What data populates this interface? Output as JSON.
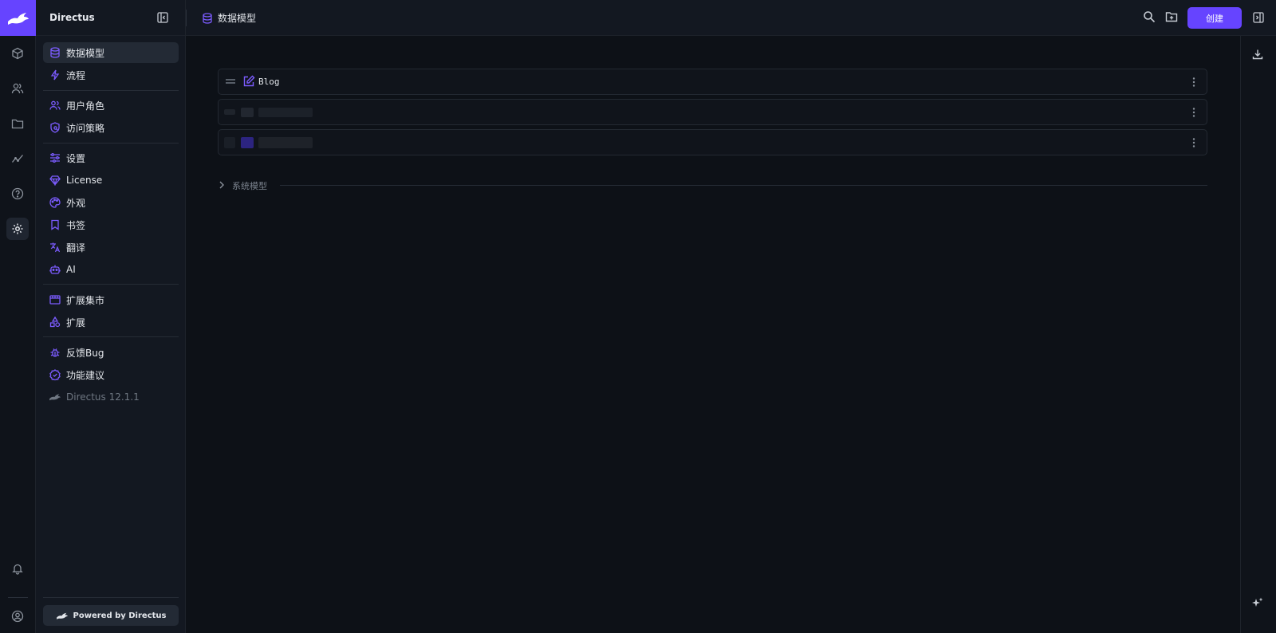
{
  "app": {
    "name": "Directus",
    "accent": "#6644ff"
  },
  "modules": [
    "content-module-icon",
    "users-module-icon",
    "files-module-icon",
    "insights-module-icon",
    "help-module-icon",
    "settings-module-icon"
  ],
  "nav": {
    "items": [
      {
        "label": "数据模型",
        "icon": "database-icon"
      },
      {
        "label": "流程",
        "icon": "bolt-icon"
      },
      {
        "label": "用户角色",
        "icon": "group-icon"
      },
      {
        "label": "访问策略",
        "icon": "policy-icon"
      },
      {
        "label": "设置",
        "icon": "sliders-icon"
      },
      {
        "label": "License",
        "icon": "diamond-icon"
      },
      {
        "label": "外观",
        "icon": "palette-icon"
      },
      {
        "label": "书签",
        "icon": "bookmark-icon"
      },
      {
        "label": "翻译",
        "icon": "translate-icon"
      },
      {
        "label": "AI",
        "icon": "robot-icon"
      },
      {
        "label": "扩展集市",
        "icon": "storefront-icon"
      },
      {
        "label": "扩展",
        "icon": "shapes-icon"
      },
      {
        "label": "反馈Bug",
        "icon": "bug-icon"
      },
      {
        "label": "功能建议",
        "icon": "verified-icon"
      },
      {
        "label": "Directus 12.1.1",
        "icon": "directus-logo-icon"
      }
    ],
    "powered_by": "Powered by Directus"
  },
  "header": {
    "breadcrumb": "数据模型",
    "create_label": "创建"
  },
  "collections": [
    {
      "name": "Blog",
      "icon": "edit-note-icon"
    }
  ],
  "system_collections_label": "系统模型"
}
